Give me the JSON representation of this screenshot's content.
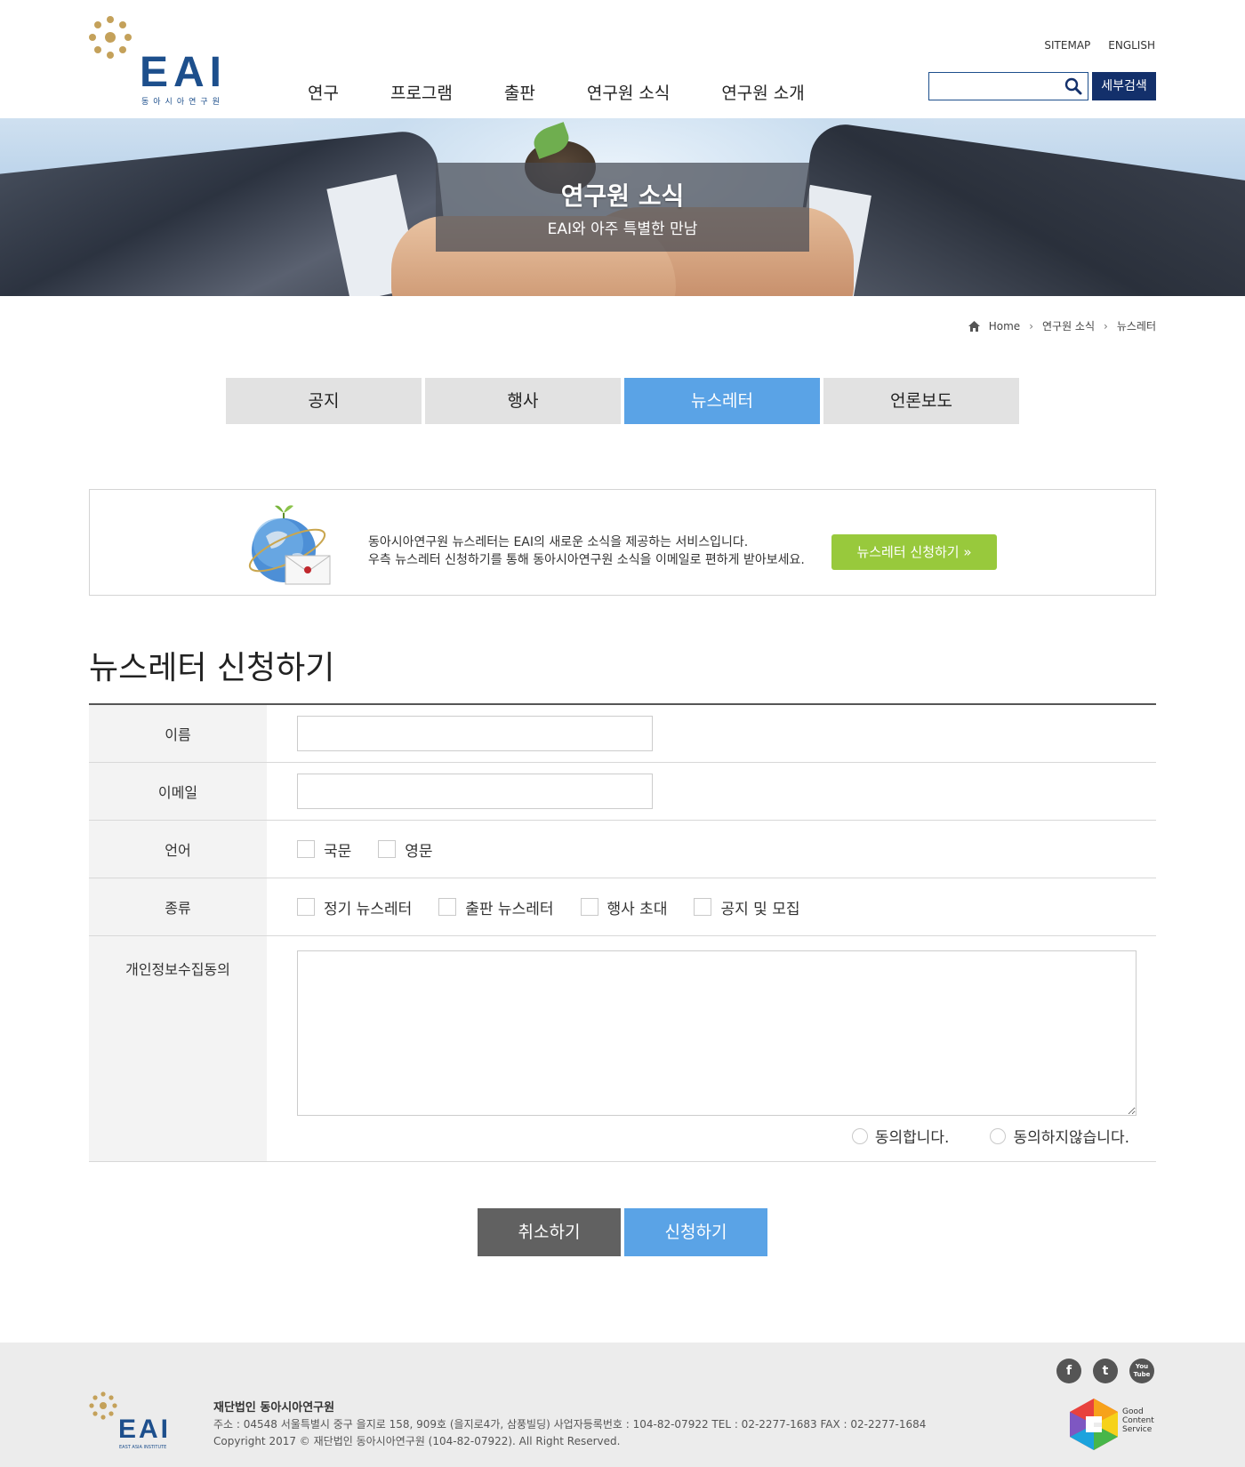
{
  "header": {
    "logo_text": "EAI",
    "logo_sub": "동아시아연구원",
    "util_links": [
      "SITEMAP",
      "ENGLISH"
    ],
    "nav": [
      "연구",
      "프로그램",
      "출판",
      "연구원 소식",
      "연구원 소개"
    ],
    "search_placeholder": "",
    "advanced_search_label": "세부검색"
  },
  "banner": {
    "title": "연구원 소식",
    "subtitle": "EAI와 아주 특별한 만남"
  },
  "breadcrumb": {
    "home": "Home",
    "level1": "연구원 소식",
    "level2": "뉴스레터"
  },
  "tabs": [
    {
      "label": "공지",
      "active": false
    },
    {
      "label": "행사",
      "active": false
    },
    {
      "label": "뉴스레터",
      "active": true
    },
    {
      "label": "언론보도",
      "active": false
    }
  ],
  "intro": {
    "line1": "동아시아연구원 뉴스레터는 EAI의 새로운 소식을 제공하는 서비스입니다.",
    "line2": "우측 뉴스레터 신청하기를 통해 동아시아연구원 소식을 이메일로 편하게 받아보세요.",
    "button": "뉴스레터 신청하기 »"
  },
  "form": {
    "title": "뉴스레터 신청하기",
    "name_label": "이름",
    "name_value": "",
    "email_label": "이메일",
    "email_value": "",
    "language_label": "언어",
    "languages": [
      "국문",
      "영문"
    ],
    "type_label": "종류",
    "types": [
      "정기 뉴스레터",
      "출판 뉴스레터",
      "행사 초대",
      "공지 및 모집"
    ],
    "privacy_label": "개인정보수집동의",
    "privacy_text": "",
    "agree_label": "동의합니다.",
    "disagree_label": "동의하지않습니다.",
    "cancel_button": "취소하기",
    "submit_button": "신청하기"
  },
  "footer": {
    "logo_text": "EAI",
    "logo_sub": "EAST ASIA INSTITUTE",
    "org": "재단법인 동아시아연구원",
    "address": "주소 : 04548 서울특별시 중구 을지로 158, 909호 (을지로4가, 삼풍빌딩)     사업자등록번호 : 104-82-07922     TEL : 02-2277-1683   FAX : 02-2277-1684",
    "copyright": "Copyright 2017 © 재단법인 동아시아연구원 (104-82-07922). All Right Reserved.",
    "social": [
      "f",
      "t",
      "You Tube"
    ],
    "gcs": [
      "Good",
      "Content",
      "Service"
    ]
  },
  "colors": {
    "brand_blue": "#1d4f8c",
    "nav_dark": "#13306b",
    "accent_blue": "#5aa3e6",
    "accent_green": "#98c93c",
    "gold": "#c4a15a"
  }
}
